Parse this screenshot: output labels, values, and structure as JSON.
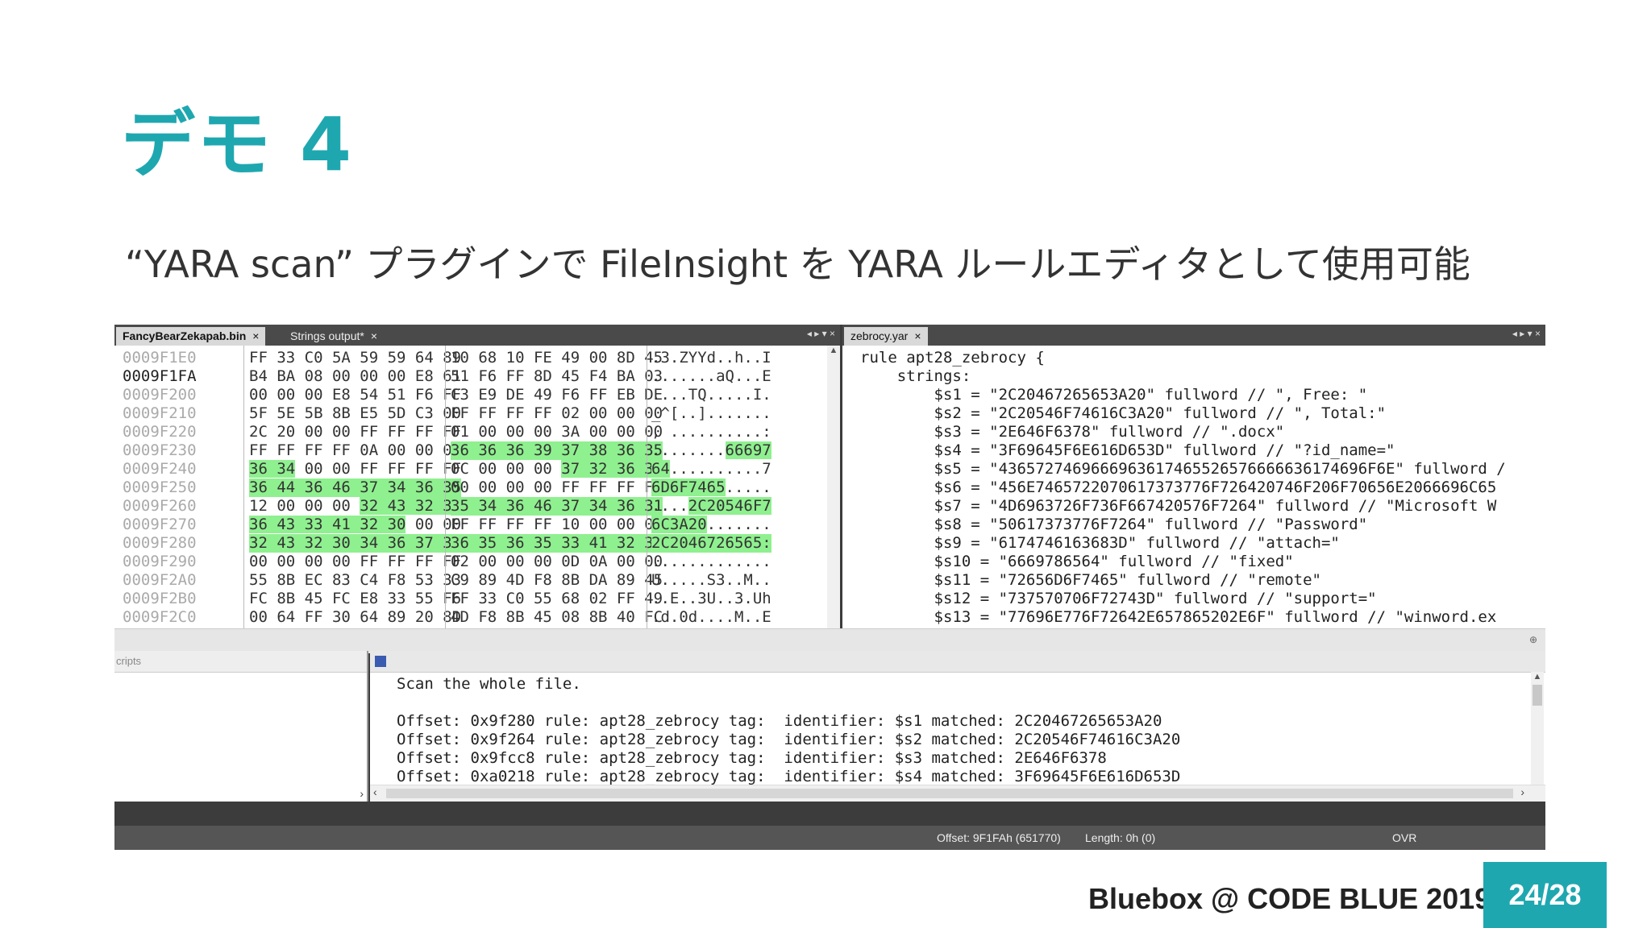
{
  "slide": {
    "title": "デモ 4",
    "subtitle": "“YARA scan” プラグインで FileInsight を YARA ルールエディタとして使用可能",
    "footer": "Bluebox @ CODE BLUE 2019",
    "page": "24/28"
  },
  "left_tabs": {
    "tab1": "FancyBearZekapab.bin",
    "tab2": "Strings output*",
    "close": "×",
    "controls": "◂ ▸ ▾ ×"
  },
  "right_tabs": {
    "tab1": "zebrocy.yar",
    "close": "×",
    "controls": "◂ ▸ ▾ ×"
  },
  "hex_rows": [
    {
      "off": "0009F1E0",
      "b1": "FF 33 C0 5A 59 59 64 89",
      "b2": "10 68 10 FE 49 00 8D 45",
      "a": ".3.ZYYd..h..I"
    },
    {
      "off": "0009F1FA",
      "b1": "B4 BA 08 00 00 00 E8 61",
      "b2": "51 F6 FF 8D 45 F4 BA 03",
      "a": ".......aQ...E"
    },
    {
      "off": "0009F200",
      "b1": "00 00 00 E8 54 51 F6 FF",
      "b2": "C3 E9 DE 49 F6 FF EB DE",
      "a": "....TQ.....I."
    },
    {
      "off": "0009F210",
      "b1": "5F 5E 5B 8B E5 5D C3 00",
      "b2": "FF FF FF FF 02 00 00 00",
      "a": "_^[..]......."
    },
    {
      "off": "0009F220",
      "b1": "2C 20 00 00 FF FF FF FF",
      "b2": "01 00 00 00 3A 00 00 00",
      "a": ", ..........:"
    },
    {
      "off": "0009F230",
      "b1": "FF FF FF FF 0A 00 00 00",
      "b2": "36 36 36 39 37 38 36 35",
      "a": "........66697"
    },
    {
      "off": "0009F240",
      "b1": "36 34 00 00 FF FF FF FF",
      "b2": "0C 00 00 00 37 32 36 35",
      "a": "64..........7"
    },
    {
      "off": "0009F250",
      "b1": "36 44 36 46 37 34 36 35",
      "b2": "00 00 00 00 FF FF FF FF",
      "a": "6D6F7465....."
    },
    {
      "off": "0009F260",
      "b1": "12 00 00 00 32 43 32 30",
      "b2": "35 34 36 46 37 34 36 31",
      "a": "....2C20546F7"
    },
    {
      "off": "0009F270",
      "b1": "36 43 33 41 32 30 00 00",
      "b2": "FF FF FF FF 10 00 00 00",
      "a": "6C3A20......."
    },
    {
      "off": "0009F280",
      "b1": "32 43 32 30 34 36 37 32",
      "b2": "36 35 36 35 33 41 32 30",
      "a": "2C2046726565:"
    },
    {
      "off": "0009F290",
      "b1": "00 00 00 00 FF FF FF FF",
      "b2": "02 00 00 00 0D 0A 00 00",
      "a": "............."
    },
    {
      "off": "0009F2A0",
      "b1": "55 8B EC 83 C4 F8 53 33",
      "b2": "C9 89 4D F8 8B DA 89 45",
      "a": "U.....S3..M.."
    },
    {
      "off": "0009F2B0",
      "b1": "FC 8B 45 FC E8 33 55 F6",
      "b2": "FF 33 C0 55 68 02 FF 49",
      "a": "..E..3U..3.Uh"
    },
    {
      "off": "0009F2C0",
      "b1": "00 64 FF 30 64 89 20 8D",
      "b2": "4D F8 8B 45 08 8B 40 FC",
      "a": ".d.0d....M..E"
    }
  ],
  "yara_lines": [
    "rule apt28_zebrocy {",
    "    strings:",
    "        $s1 = \"2C20467265653A20\" fullword // \", Free: \"",
    "        $s2 = \"2C20546F74616C3A20\" fullword // \", Total:\"",
    "        $s3 = \"2E646F6378\" fullword // \".docx\"",
    "        $s4 = \"3F69645F6E616D653D\" fullword // \"?id_name=\"",
    "        $s5 = \"4365727469666963617465526576666636174696F6E\" fullword /",
    "        $s6 = \"456E7465722070617373776F726420746F206F70656E2066696C65",
    "        $s7 = \"4D6963726F736F667420576F7264\" fullword // \"Microsoft W",
    "        $s8 = \"50617373776F7264\" fullword // \"Password\"",
    "        $s9 = \"6174746163683D\" fullword // \"attach=\"",
    "        $s10 = \"6669786564\" fullword // \"fixed\"",
    "        $s11 = \"72656D6F7465\" fullword // \"remote\"",
    "        $s12 = \"737570706F72743D\" fullword // \"support=\"",
    "        $s13 = \"77696E776F72642E657865202E6F\" fullword // \"winword.ex"
  ],
  "left_panel": {
    "header": "cripts"
  },
  "output": {
    "line0": "Scan the whole file.",
    "lines": [
      "Offset: 0x9f280 rule: apt28_zebrocy tag:  identifier: $s1 matched: 2C20467265653A20",
      "Offset: 0x9f264 rule: apt28_zebrocy tag:  identifier: $s2 matched: 2C20546F74616C3A20",
      "Offset: 0x9fcc8 rule: apt28_zebrocy tag:  identifier: $s3 matched: 2E646F6378",
      "Offset: 0xa0218 rule: apt28_zebrocy tag:  identifier: $s4 matched: 3F69645F6E616D653D"
    ]
  },
  "statusbar": {
    "offset": "Offset: 9F1FAh (651770)",
    "length": "Length: 0h (0)",
    "mode": "OVR"
  }
}
